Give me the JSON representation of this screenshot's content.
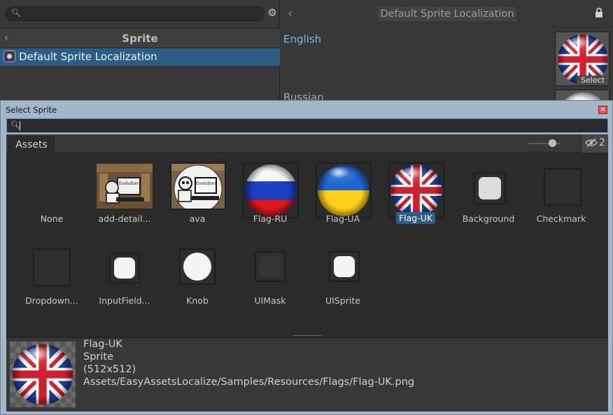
{
  "top_left": {
    "search": {
      "value": "",
      "placeholder": ""
    },
    "header_title": "Sprite",
    "tree_item": "Default Sprite Localization"
  },
  "top_right": {
    "title": "Default Sprite Localization",
    "lang_english": "English",
    "lang_russian": "Russian",
    "select_label": "Select"
  },
  "dialog": {
    "title": "Select Sprite",
    "close_glyph": "×",
    "search_value": "",
    "tab_label": "Assets",
    "hidden_count": "2",
    "zoom_level": 0.75,
    "items": [
      {
        "label": "None"
      },
      {
        "label": "add-detail..."
      },
      {
        "label": "ava"
      },
      {
        "label": "Flag-RU"
      },
      {
        "label": "Flag-UA"
      },
      {
        "label": "Flag-UK",
        "selected": true
      },
      {
        "label": "Background"
      },
      {
        "label": "Checkmark"
      },
      {
        "label": "Dropdown..."
      },
      {
        "label": "InputField..."
      },
      {
        "label": "Knob"
      },
      {
        "label": "UIMask"
      },
      {
        "label": "UISprite"
      }
    ],
    "thumb_text": {
      "card1": "Evolution",
      "card2": "Evolution"
    },
    "preview": {
      "name": "Flag-UK",
      "type": "Sprite",
      "size": "(512x512)",
      "path": "Assets/EasyAssetsLocalize/Samples/Resources/Flags/Flag-UK.png"
    }
  },
  "colors": {
    "selection": "#2c5d87",
    "accent_text": "#7ab4f0",
    "dialog_frame": "#a5b6c6"
  },
  "icons": [
    "search-icon",
    "gear-icon",
    "chevron-left-icon",
    "lock-icon",
    "close-icon",
    "eye-slash-icon"
  ]
}
